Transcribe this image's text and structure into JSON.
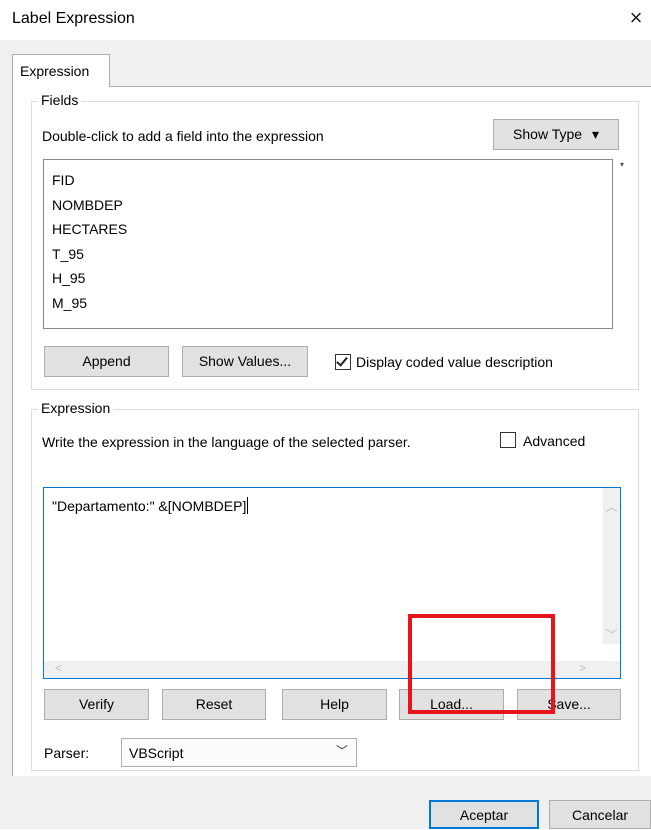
{
  "window": {
    "title": "Label Expression",
    "close_glyph": "×"
  },
  "tab": {
    "label": "Expression"
  },
  "fields_group": {
    "legend": "Fields",
    "instruction": "Double-click to add a field into the expression",
    "show_type_label": "Show Type",
    "show_type_arrow": "▾",
    "fields": [
      "FID",
      "NOMBDEP",
      "HECTARES",
      "T_95",
      "H_95",
      "M_95"
    ],
    "append_label": "Append",
    "show_values_label": "Show Values...",
    "display_coded_label": "Display coded value description",
    "display_coded_checked": true
  },
  "expression_group": {
    "legend": "Expression",
    "instruction": "Write the expression in the language of the selected parser.",
    "advanced_label": "Advanced",
    "advanced_checked": false,
    "expression_text": "\"Departamento:\" &[NOMBDEP]",
    "verify_label": "Verify",
    "reset_label": "Reset",
    "help_label": "Help",
    "load_label": "Load...",
    "save_label": "Save..."
  },
  "parser": {
    "label": "Parser:",
    "value": "VBScript"
  },
  "dialog_buttons": {
    "accept_label": "Aceptar",
    "cancel_label": "Cancelar"
  },
  "colors": {
    "highlight": "#e8141b",
    "focus": "#0078d7"
  }
}
